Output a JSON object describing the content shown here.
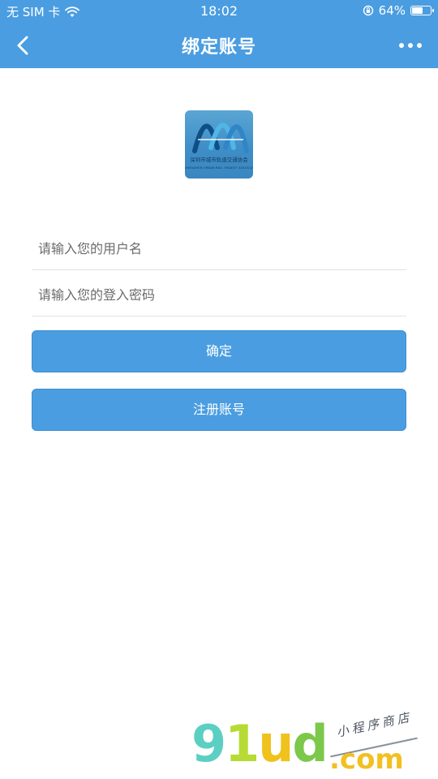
{
  "status_bar": {
    "carrier": "无 SIM 卡",
    "time": "18:02",
    "battery_percent": "64%",
    "battery_level": 0.64
  },
  "nav": {
    "title": "绑定账号",
    "back_icon": "chevron-left-icon",
    "more_icon": "more-dots-icon"
  },
  "logo": {
    "cn_text": "深圳市城市轨道交通协会",
    "en_text": "SHENZHEN URBAN RAIL TRANSIT ASSOCIATION"
  },
  "form": {
    "username_placeholder": "请输入您的用户名",
    "password_placeholder": "请输入您的登入密码",
    "confirm_label": "确定",
    "register_label": "注册账号"
  },
  "watermark": {
    "brand": "91ud",
    "domain": ".com",
    "tagline": "小程序商店"
  },
  "colors": {
    "accent": "#4a9de0",
    "background": "#ffffff"
  }
}
